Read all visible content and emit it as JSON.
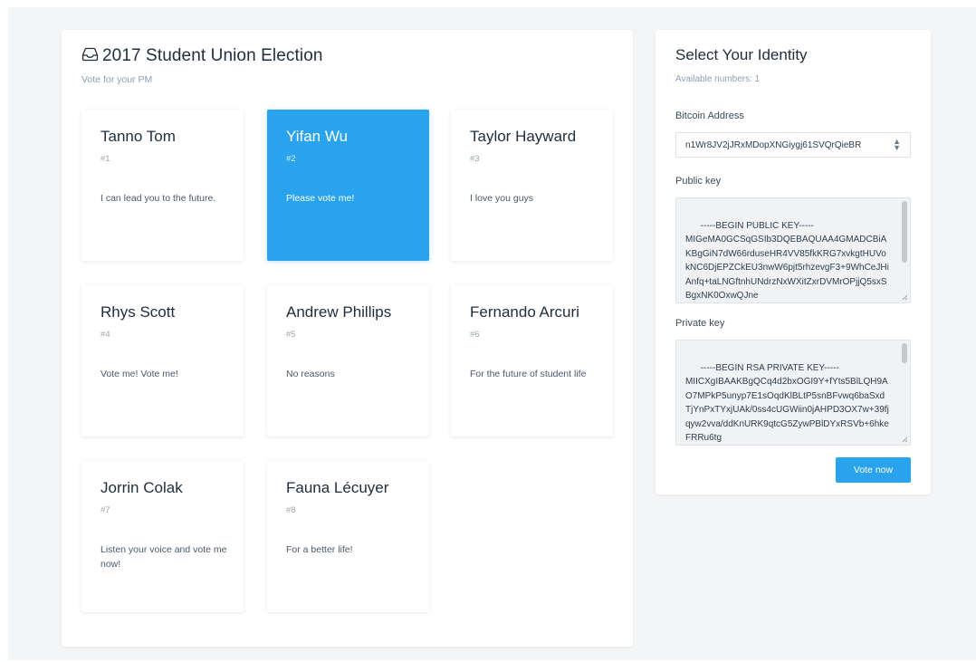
{
  "election": {
    "title": "2017 Student Union Election",
    "subtitle": "Vote for your PM",
    "candidates": [
      {
        "name": "Tanno Tom",
        "number": "#1",
        "description": "I can lead you to the future.",
        "selected": false
      },
      {
        "name": "Yifan Wu",
        "number": "#2",
        "description": "Please vote me!",
        "selected": true
      },
      {
        "name": "Taylor Hayward",
        "number": "#3",
        "description": "I love you guys",
        "selected": false
      },
      {
        "name": "Rhys Scott",
        "number": "#4",
        "description": "Vote me! Vote me!",
        "selected": false
      },
      {
        "name": "Andrew Phillips",
        "number": "#5",
        "description": "No reasons",
        "selected": false
      },
      {
        "name": "Fernando Arcuri",
        "number": "#6",
        "description": "For the future of student life",
        "selected": false
      },
      {
        "name": "Jorrin Colak",
        "number": "#7",
        "description": "Listen your voice and vote me now!",
        "selected": false
      },
      {
        "name": "Fauna Lécuyer",
        "number": "#8",
        "description": "For a better life!",
        "selected": false
      }
    ]
  },
  "identity": {
    "title": "Select Your Identity",
    "available": "Available numbers: 1",
    "bitcoin_label": "Bitcoin Address",
    "bitcoin_address": "n1Wr8JV2jJRxMDopXNGiygj61SVQrQieBR",
    "public_key_label": "Public key",
    "public_key": "-----BEGIN PUBLIC KEY-----\nMIGeMA0GCSqGSIb3DQEBAQUAA4GMADCBiAKBgGiN7dW66rduseHR4VV85fkKRG7xvkgtHUVokNC6DjEPZCkEU3nwW6pjt5rhzevgF3+9WhCeJHiAnfq+taLNGftnhUNdrzNxWXitZxrDVMrOPjjQ5sxSBgxNK0OxwQJne",
    "private_key_label": "Private key",
    "private_key": "-----BEGIN RSA PRIVATE KEY-----\nMIICXgIBAAKBgQCq4d2bxOGI9Y+fYts5BlLQH9AO7MPkP5unyp7E1sOqdKlBLtP5snBFvwq6baSxdTjYnPxTYxjUAk/0ss4cUGWiin0jAHPD3OX7w+39fjqyw2vva/ddKnURK9qtcG5ZywPBlDYxRSVb+6hkeFRRu6tg",
    "vote_button": "Vote now",
    "accent_color": "#2aa3ef"
  }
}
